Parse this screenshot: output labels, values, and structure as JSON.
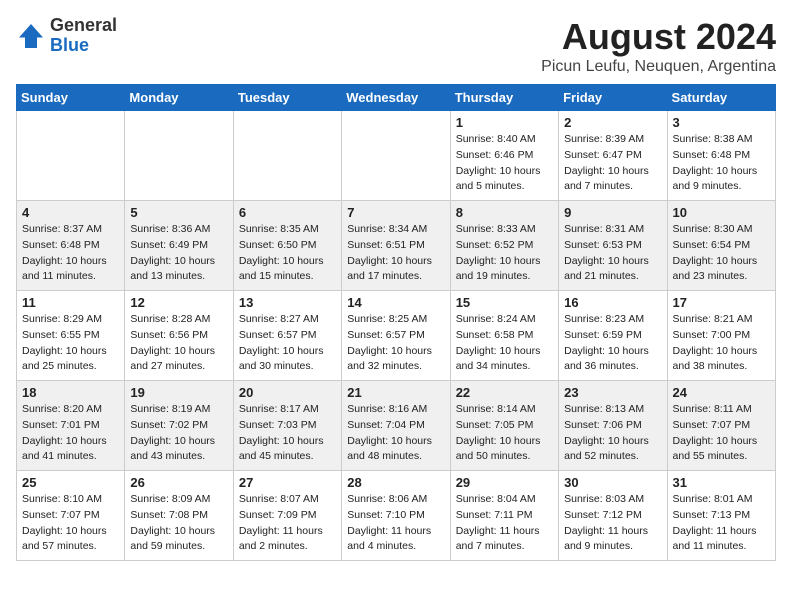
{
  "header": {
    "logo_general": "General",
    "logo_blue": "Blue",
    "month_year": "August 2024",
    "location": "Picun Leufu, Neuquen, Argentina"
  },
  "weekdays": [
    "Sunday",
    "Monday",
    "Tuesday",
    "Wednesday",
    "Thursday",
    "Friday",
    "Saturday"
  ],
  "weeks": [
    [
      {
        "day": "",
        "info": ""
      },
      {
        "day": "",
        "info": ""
      },
      {
        "day": "",
        "info": ""
      },
      {
        "day": "",
        "info": ""
      },
      {
        "day": "1",
        "info": "Sunrise: 8:40 AM\nSunset: 6:46 PM\nDaylight: 10 hours\nand 5 minutes."
      },
      {
        "day": "2",
        "info": "Sunrise: 8:39 AM\nSunset: 6:47 PM\nDaylight: 10 hours\nand 7 minutes."
      },
      {
        "day": "3",
        "info": "Sunrise: 8:38 AM\nSunset: 6:48 PM\nDaylight: 10 hours\nand 9 minutes."
      }
    ],
    [
      {
        "day": "4",
        "info": "Sunrise: 8:37 AM\nSunset: 6:48 PM\nDaylight: 10 hours\nand 11 minutes."
      },
      {
        "day": "5",
        "info": "Sunrise: 8:36 AM\nSunset: 6:49 PM\nDaylight: 10 hours\nand 13 minutes."
      },
      {
        "day": "6",
        "info": "Sunrise: 8:35 AM\nSunset: 6:50 PM\nDaylight: 10 hours\nand 15 minutes."
      },
      {
        "day": "7",
        "info": "Sunrise: 8:34 AM\nSunset: 6:51 PM\nDaylight: 10 hours\nand 17 minutes."
      },
      {
        "day": "8",
        "info": "Sunrise: 8:33 AM\nSunset: 6:52 PM\nDaylight: 10 hours\nand 19 minutes."
      },
      {
        "day": "9",
        "info": "Sunrise: 8:31 AM\nSunset: 6:53 PM\nDaylight: 10 hours\nand 21 minutes."
      },
      {
        "day": "10",
        "info": "Sunrise: 8:30 AM\nSunset: 6:54 PM\nDaylight: 10 hours\nand 23 minutes."
      }
    ],
    [
      {
        "day": "11",
        "info": "Sunrise: 8:29 AM\nSunset: 6:55 PM\nDaylight: 10 hours\nand 25 minutes."
      },
      {
        "day": "12",
        "info": "Sunrise: 8:28 AM\nSunset: 6:56 PM\nDaylight: 10 hours\nand 27 minutes."
      },
      {
        "day": "13",
        "info": "Sunrise: 8:27 AM\nSunset: 6:57 PM\nDaylight: 10 hours\nand 30 minutes."
      },
      {
        "day": "14",
        "info": "Sunrise: 8:25 AM\nSunset: 6:57 PM\nDaylight: 10 hours\nand 32 minutes."
      },
      {
        "day": "15",
        "info": "Sunrise: 8:24 AM\nSunset: 6:58 PM\nDaylight: 10 hours\nand 34 minutes."
      },
      {
        "day": "16",
        "info": "Sunrise: 8:23 AM\nSunset: 6:59 PM\nDaylight: 10 hours\nand 36 minutes."
      },
      {
        "day": "17",
        "info": "Sunrise: 8:21 AM\nSunset: 7:00 PM\nDaylight: 10 hours\nand 38 minutes."
      }
    ],
    [
      {
        "day": "18",
        "info": "Sunrise: 8:20 AM\nSunset: 7:01 PM\nDaylight: 10 hours\nand 41 minutes."
      },
      {
        "day": "19",
        "info": "Sunrise: 8:19 AM\nSunset: 7:02 PM\nDaylight: 10 hours\nand 43 minutes."
      },
      {
        "day": "20",
        "info": "Sunrise: 8:17 AM\nSunset: 7:03 PM\nDaylight: 10 hours\nand 45 minutes."
      },
      {
        "day": "21",
        "info": "Sunrise: 8:16 AM\nSunset: 7:04 PM\nDaylight: 10 hours\nand 48 minutes."
      },
      {
        "day": "22",
        "info": "Sunrise: 8:14 AM\nSunset: 7:05 PM\nDaylight: 10 hours\nand 50 minutes."
      },
      {
        "day": "23",
        "info": "Sunrise: 8:13 AM\nSunset: 7:06 PM\nDaylight: 10 hours\nand 52 minutes."
      },
      {
        "day": "24",
        "info": "Sunrise: 8:11 AM\nSunset: 7:07 PM\nDaylight: 10 hours\nand 55 minutes."
      }
    ],
    [
      {
        "day": "25",
        "info": "Sunrise: 8:10 AM\nSunset: 7:07 PM\nDaylight: 10 hours\nand 57 minutes."
      },
      {
        "day": "26",
        "info": "Sunrise: 8:09 AM\nSunset: 7:08 PM\nDaylight: 10 hours\nand 59 minutes."
      },
      {
        "day": "27",
        "info": "Sunrise: 8:07 AM\nSunset: 7:09 PM\nDaylight: 11 hours\nand 2 minutes."
      },
      {
        "day": "28",
        "info": "Sunrise: 8:06 AM\nSunset: 7:10 PM\nDaylight: 11 hours\nand 4 minutes."
      },
      {
        "day": "29",
        "info": "Sunrise: 8:04 AM\nSunset: 7:11 PM\nDaylight: 11 hours\nand 7 minutes."
      },
      {
        "day": "30",
        "info": "Sunrise: 8:03 AM\nSunset: 7:12 PM\nDaylight: 11 hours\nand 9 minutes."
      },
      {
        "day": "31",
        "info": "Sunrise: 8:01 AM\nSunset: 7:13 PM\nDaylight: 11 hours\nand 11 minutes."
      }
    ]
  ]
}
